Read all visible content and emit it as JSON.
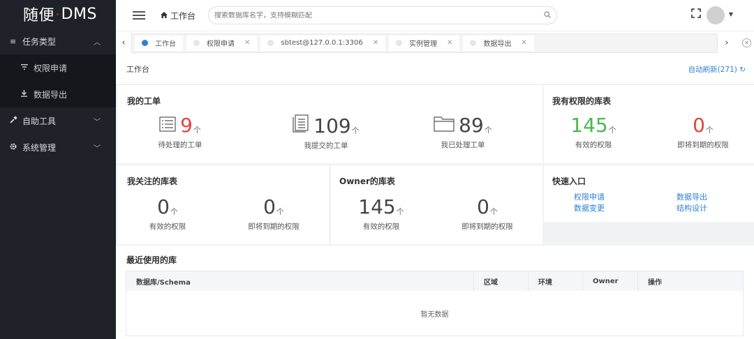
{
  "brand": {
    "left": "随便",
    "dot": "·",
    "right": "DMS"
  },
  "sidebar": {
    "groups": [
      {
        "label": "任务类型",
        "icon": "list-icon",
        "expanded": true,
        "items": [
          {
            "label": "权限申请",
            "icon": "filter-icon"
          },
          {
            "label": "数据导出",
            "icon": "download-icon"
          }
        ]
      },
      {
        "label": "自助工具",
        "icon": "tools-icon",
        "expanded": false
      },
      {
        "label": "系统管理",
        "icon": "gear-icon",
        "expanded": false
      }
    ]
  },
  "header": {
    "breadcrumb": "工作台",
    "search_placeholder": "搜索数据库名字，支持模糊匹配"
  },
  "tabs": [
    {
      "label": "工作台",
      "active": true,
      "closable": false
    },
    {
      "label": "权限申请",
      "active": false,
      "closable": true
    },
    {
      "label": "sbtest@127.0.0.1:3306",
      "active": false,
      "closable": true
    },
    {
      "label": "实例管理",
      "active": false,
      "closable": true
    },
    {
      "label": "数据导出",
      "active": false,
      "closable": true
    }
  ],
  "page": {
    "title": "工作台",
    "refresh": "自动刷新(271)"
  },
  "my_orders": {
    "title": "我的工单",
    "unit": "个",
    "stats": [
      {
        "value": "9",
        "caption": "待处理的工单",
        "color": "#e0463b"
      },
      {
        "value": "109",
        "caption": "我提交的工单",
        "color": "#444444"
      },
      {
        "value": "89",
        "caption": "我已处理工单",
        "color": "#444444"
      }
    ]
  },
  "my_perm_tables": {
    "title": "我有权限的库表",
    "unit": "个",
    "stats": [
      {
        "value": "145",
        "caption": "有效的权限",
        "color": "#4cb84c"
      },
      {
        "value": "0",
        "caption": "即将到期的权限",
        "color": "#e0463b"
      }
    ]
  },
  "followed_tables": {
    "title": "我关注的库表",
    "unit": "个",
    "stats": [
      {
        "value": "0",
        "caption": "有效的权限"
      },
      {
        "value": "0",
        "caption": "即将到期的权限"
      }
    ]
  },
  "owner_tables": {
    "title": "Owner的库表",
    "unit": "个",
    "stats": [
      {
        "value": "145",
        "caption": "有效的权限"
      },
      {
        "value": "0",
        "caption": "即将到期的权限"
      }
    ]
  },
  "quick": {
    "title": "快速入口",
    "links": [
      "权限申请",
      "数据导出",
      "数据变更",
      "结构设计"
    ]
  },
  "recent": {
    "title": "最近使用的库",
    "columns": [
      "数据库/Schema",
      "区域",
      "环境",
      "Owner",
      "操作"
    ],
    "empty": "暂无数据"
  }
}
